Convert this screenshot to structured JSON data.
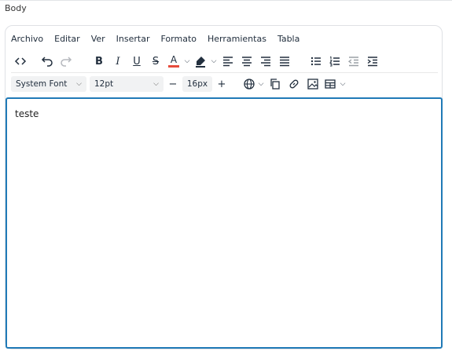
{
  "field_label": "Body",
  "menubar": [
    "Archivo",
    "Editar",
    "Ver",
    "Insertar",
    "Formato",
    "Herramientas",
    "Tabla"
  ],
  "toolbar": {
    "bold_label": "B",
    "italic_label": "I",
    "underline_label": "U",
    "strike_label": "S",
    "text_color_label": "A",
    "font_family": "System Font",
    "font_size": "12pt",
    "line_height": "16px",
    "minus_label": "−",
    "plus_label": "+",
    "text_color": "#e74c3c",
    "highlight_color": "#222f3e"
  },
  "content": {
    "text": "teste"
  },
  "accent_color": "#207ab7"
}
